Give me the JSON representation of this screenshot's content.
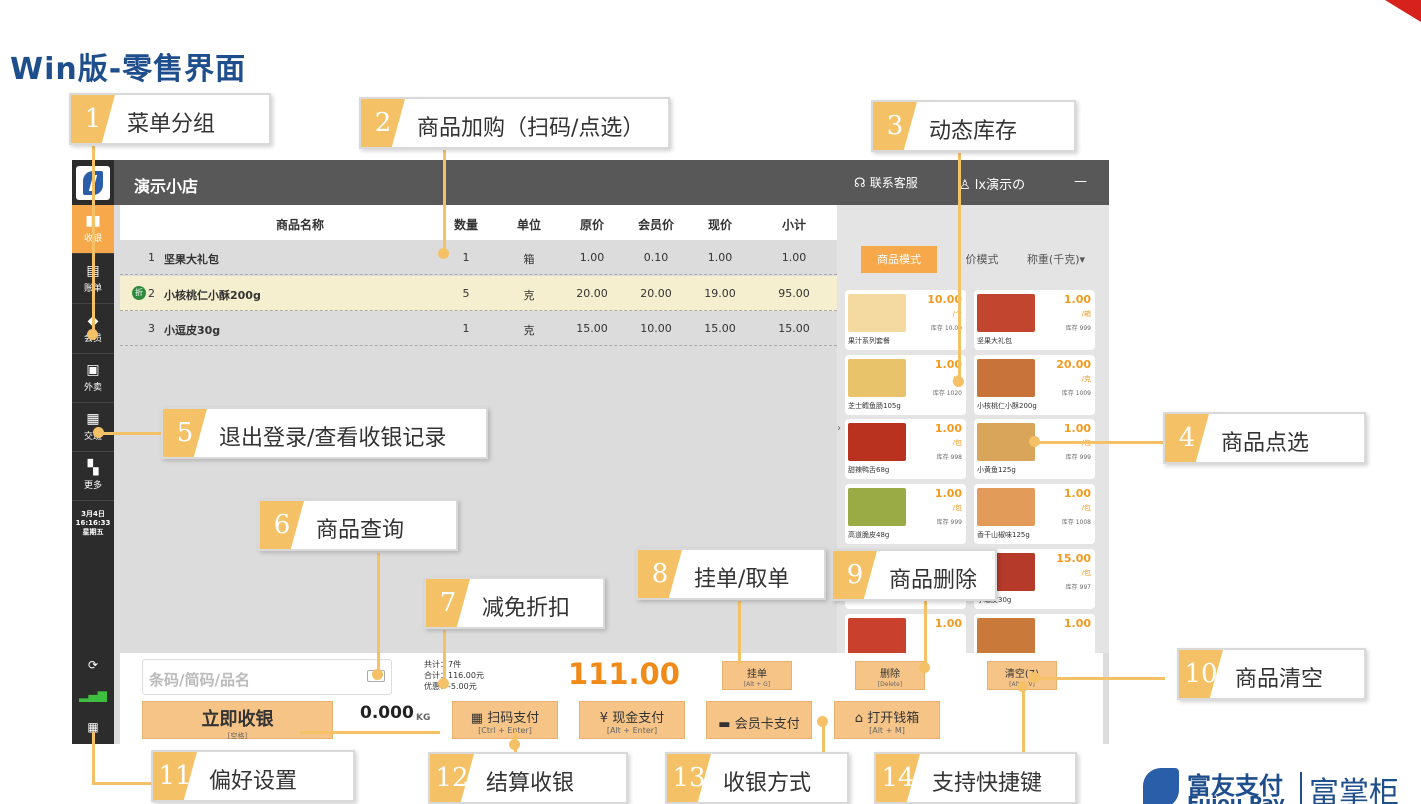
{
  "page_title": "Win版-零售界面",
  "app": {
    "store_name": "演示小店",
    "support_label": "联系客服",
    "user_label": "lx演示の",
    "minimize": "—"
  },
  "sidebar": {
    "items": [
      {
        "label": "收银",
        "icon": "cart-icon"
      },
      {
        "label": "账单",
        "icon": "bill-icon"
      },
      {
        "label": "会员",
        "icon": "member-icon"
      },
      {
        "label": "外卖",
        "icon": "takeout-icon"
      },
      {
        "label": "交班",
        "icon": "handover-icon"
      },
      {
        "label": "更多",
        "icon": "grid-icon"
      }
    ],
    "date": "3月4日",
    "time": "16:16:33",
    "weekday": "星期五"
  },
  "table": {
    "headers": [
      "商品名称",
      "数量",
      "单位",
      "原价",
      "会员价",
      "现价",
      "小计"
    ],
    "rows": [
      {
        "idx": "1",
        "name": "坚果大礼包",
        "qty": "1",
        "unit": "箱",
        "orig": "1.00",
        "member": "0.10",
        "now": "1.00",
        "subtotal": "1.00",
        "discount": ""
      },
      {
        "idx": "2",
        "name": "小核桃仁小酥200g",
        "qty": "5",
        "unit": "克",
        "orig": "20.00",
        "member": "20.00",
        "now": "19.00",
        "subtotal": "95.00",
        "discount": "折"
      },
      {
        "idx": "3",
        "name": "小逗皮30g",
        "qty": "1",
        "unit": "克",
        "orig": "15.00",
        "member": "10.00",
        "now": "15.00",
        "subtotal": "15.00",
        "discount": ""
      }
    ]
  },
  "modes": {
    "goods": "商品模式",
    "price": "价模式",
    "scale": "称重(千克)▾"
  },
  "cards": [
    {
      "price": "10.00",
      "unit": "/个",
      "stock": "库存 10.00",
      "name": "果汁系列套餐",
      "color": "#f4d9a0"
    },
    {
      "price": "1.00",
      "unit": "/箱",
      "stock": "库存 999",
      "name": "坚果大礼包",
      "color": "#c2452f"
    },
    {
      "price": "1.00",
      "unit": "/包",
      "stock": "库存 1020",
      "name": "芝士鳕鱼肠105g",
      "color": "#e8c36a"
    },
    {
      "price": "20.00",
      "unit": "/克",
      "stock": "库存 1009",
      "name": "小核桃仁小酥200g",
      "color": "#c8733a"
    },
    {
      "price": "1.00",
      "unit": "/包",
      "stock": "库存 998",
      "name": "甜辣鸭舌68g",
      "color": "#b8321f"
    },
    {
      "price": "1.00",
      "unit": "/包",
      "stock": "库存 999",
      "name": "小黄鱼125g",
      "color": "#d9a55a"
    },
    {
      "price": "1.00",
      "unit": "/包",
      "stock": "库存 999",
      "name": "高道脆皮48g",
      "color": "#9aaa44"
    },
    {
      "price": "1.00",
      "unit": "/包",
      "stock": "库存 1008",
      "name": "香干山椒味125g",
      "color": "#e39b5a"
    },
    {
      "price": "",
      "unit": "",
      "stock": "",
      "name": "",
      "color": "#d84a3a"
    },
    {
      "price": "15.00",
      "unit": "/包",
      "stock": "库存 997",
      "name": "小逗皮30g",
      "color": "#b53a2a"
    },
    {
      "price": "1.00",
      "unit": "",
      "stock": "",
      "name": "",
      "color": "#c9402c"
    },
    {
      "price": "1.00",
      "unit": "",
      "stock": "",
      "name": "",
      "color": "#c97a3a"
    }
  ],
  "bottom": {
    "search_placeholder": "条码/简码/品名",
    "total_count": "共计：7件",
    "total_amount": "合计：116.00元",
    "discount_amount": "优惠：-5.00元",
    "grand_total": "111.00",
    "hold": {
      "label": "挂单",
      "key": "[Alt + G]"
    },
    "delete": {
      "label": "删除",
      "key": "[Delete]"
    },
    "clear": {
      "label": "清空(7)",
      "key": "[Alt + V]"
    },
    "checkout": {
      "label": "立即收银",
      "key": "[空格]"
    },
    "weight": "0.000",
    "weight_unit": "KG",
    "scan_pay": {
      "label": "扫码支付",
      "key": "[Ctrl + Enter]"
    },
    "cash_pay": {
      "label": "现金支付",
      "key": "[Alt + Enter]"
    },
    "card_pay": {
      "label": "会员卡支付"
    },
    "cash_drawer": {
      "label": "打开钱箱",
      "key": "[Alt + M]"
    }
  },
  "callouts": [
    {
      "num": "1",
      "text": "菜单分组"
    },
    {
      "num": "2",
      "text": "商品加购（扫码/点选）"
    },
    {
      "num": "3",
      "text": "动态库存"
    },
    {
      "num": "4",
      "text": "商品点选"
    },
    {
      "num": "5",
      "text": "退出登录/查看收银记录"
    },
    {
      "num": "6",
      "text": "商品查询"
    },
    {
      "num": "7",
      "text": "减免折扣"
    },
    {
      "num": "8",
      "text": "挂单/取单"
    },
    {
      "num": "9",
      "text": "商品删除"
    },
    {
      "num": "10",
      "text": "商品清空"
    },
    {
      "num": "11",
      "text": "偏好设置"
    },
    {
      "num": "12",
      "text": "结算收银"
    },
    {
      "num": "13",
      "text": "收银方式"
    },
    {
      "num": "14",
      "text": "支持快捷键"
    }
  ],
  "brand": {
    "name": "富友支付",
    "sub": "Fuiou Pay",
    "right": "富掌柜"
  }
}
